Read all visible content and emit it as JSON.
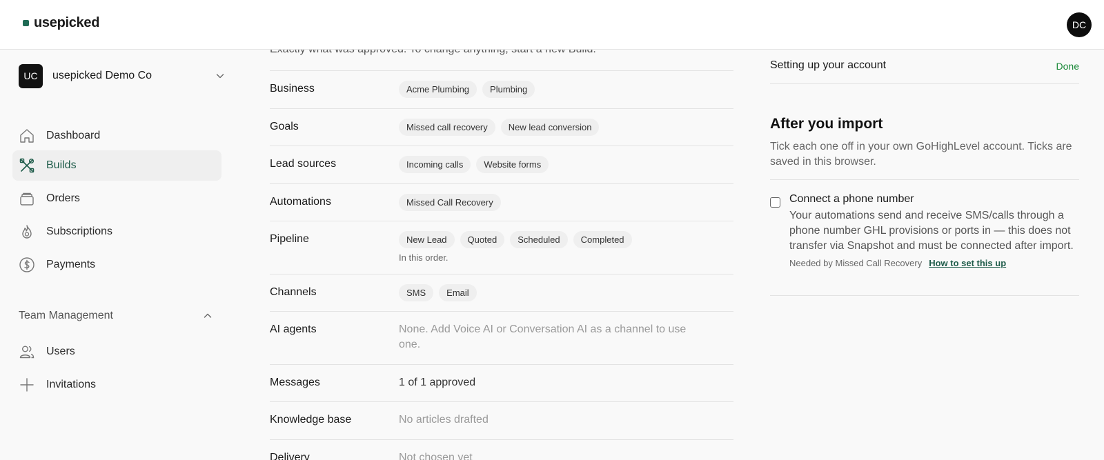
{
  "header": {
    "logo_text": "usepicked",
    "user_initials": "DC",
    "brand_color": "#1f6b55"
  },
  "sidebar": {
    "org": {
      "initials": "UC",
      "name": "usepicked Demo Co"
    },
    "items": [
      {
        "label": "Dashboard",
        "icon": "home-icon",
        "active": false
      },
      {
        "label": "Builds",
        "icon": "tools-icon",
        "active": true
      },
      {
        "label": "Orders",
        "icon": "stack-icon",
        "active": false
      },
      {
        "label": "Subscriptions",
        "icon": "flame-icon",
        "active": false
      },
      {
        "label": "Payments",
        "icon": "dollar-icon",
        "active": false
      }
    ],
    "team_section": {
      "label": "Team Management",
      "items": [
        {
          "label": "Users",
          "icon": "users-icon"
        },
        {
          "label": "Invitations",
          "icon": "plus-icon"
        }
      ]
    }
  },
  "main": {
    "intro": "Exactly what was approved. To change anything, start a new Build.",
    "rows": [
      {
        "label": "Business",
        "chips": [
          "Acme Plumbing",
          "Plumbing"
        ]
      },
      {
        "label": "Goals",
        "chips": [
          "Missed call recovery",
          "New lead conversion"
        ]
      },
      {
        "label": "Lead sources",
        "chips": [
          "Incoming calls",
          "Website forms"
        ]
      },
      {
        "label": "Automations",
        "chips": [
          "Missed Call Recovery"
        ]
      },
      {
        "label": "Pipeline",
        "chips": [
          "New Lead",
          "Quoted",
          "Scheduled",
          "Completed"
        ],
        "note": "In this order."
      },
      {
        "label": "Channels",
        "chips": [
          "SMS",
          "Email"
        ]
      },
      {
        "label": "AI agents",
        "text": "None. Add Voice AI or Conversation AI as a channel to use one."
      },
      {
        "label": "Messages",
        "value": "1 of 1 approved"
      },
      {
        "label": "Knowledge base",
        "text": "No articles drafted"
      },
      {
        "label": "Delivery",
        "text": "Not chosen yet"
      }
    ]
  },
  "right_panel": {
    "setup": {
      "label": "Setting up your account",
      "status": "Done",
      "status_color": "#1c8a3a"
    },
    "after_import": {
      "title": "After you import",
      "description": "Tick each one off in your own GoHighLevel account. Ticks are saved in this browser.",
      "task": {
        "title": "Connect a phone number",
        "description": "Your automations send and receive SMS/calls through a phone number GHL provisions or ports in — this does not transfer via Snapshot and must be connected after import.",
        "needed_by": "Needed by Missed Call Recovery",
        "link": "How to set this up",
        "checked": false
      }
    }
  }
}
